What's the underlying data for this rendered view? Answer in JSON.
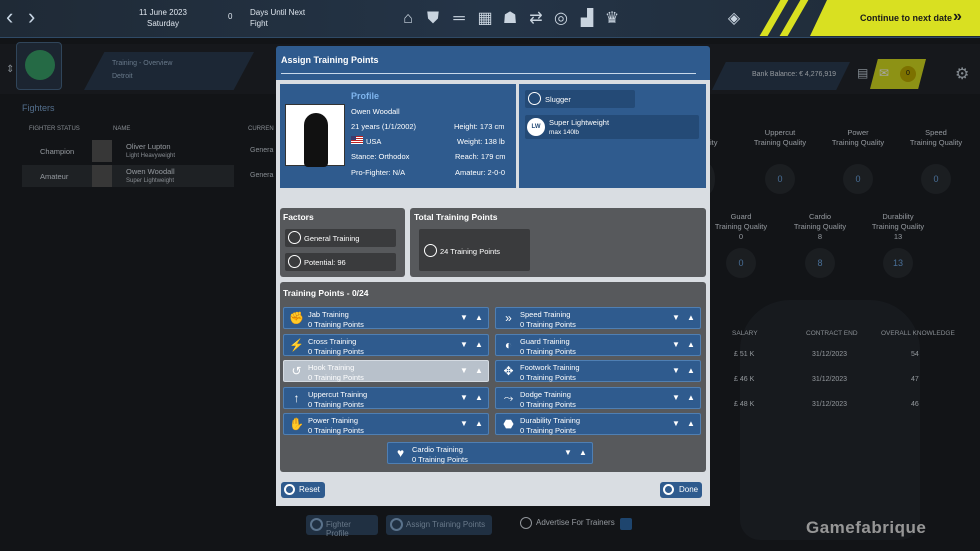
{
  "topbar": {
    "date": "11 June 2023",
    "weekday": "Saturday",
    "days_value": "0",
    "days_label_1": "Days Until Next",
    "days_label_2": "Fight",
    "continue_label": "Continue to next date",
    "nav_icons": [
      "home-icon",
      "shield-icon",
      "dumbbell-icon",
      "calendar-icon",
      "team-icon",
      "transfer-icon",
      "target-icon",
      "stats-icon",
      "trophy-icon"
    ]
  },
  "header": {
    "crumb_title": "Training - Overview",
    "crumb_location": "Detroit",
    "bank_balance": "Bank Balance: € 4,276,919",
    "mail_count": "0"
  },
  "fighters": {
    "title": "Fighters",
    "col_status": "FIGHTER STATUS",
    "col_name": "NAME",
    "col_current": "CURREN",
    "rows": [
      {
        "status": "Champion",
        "name": "Oliver Lupton",
        "weight": "Light Heavyweight",
        "current": "Genera"
      },
      {
        "status": "Amateur",
        "name": "Owen Woodall",
        "weight": "Super Lightweight",
        "current": "Genera"
      }
    ]
  },
  "stats": {
    "row1": [
      {
        "title1": "Uppercut",
        "title2": "Training Quality",
        "value": "0"
      },
      {
        "title1": "Power",
        "title2": "Training Quality",
        "value": "0"
      },
      {
        "title1": "Speed",
        "title2": "Training Quality",
        "value": "0"
      }
    ],
    "row1_partial": "uality",
    "row1_partial_value": "0",
    "row2": [
      {
        "title1": "Guard",
        "title2": "Training Quality",
        "num": "0",
        "value": "0"
      },
      {
        "title1": "Cardio",
        "title2": "Training Quality",
        "num": "8",
        "value": "8"
      },
      {
        "title1": "Durability",
        "title2": "Training Quality",
        "num": "13",
        "value": "13"
      }
    ]
  },
  "coaches": {
    "headers": [
      "SALARY",
      "CONTRACT END",
      "OVERALL KNOWLEDGE"
    ],
    "rows": [
      [
        "£ 51 K",
        "31/12/2023",
        "54"
      ],
      [
        "£ 46 K",
        "31/12/2023",
        "47"
      ],
      [
        "£ 48 K",
        "31/12/2023",
        "46"
      ]
    ]
  },
  "page_buttons": {
    "fighter_profile": "Fighter Profile",
    "assign_training": "Assign Training Points",
    "advertise": "Advertise For Trainers"
  },
  "watermark": "Gamefabrique",
  "modal": {
    "title": "Assign Training Points",
    "profile": {
      "heading": "Profile",
      "name": "Owen Woodall",
      "age": "21 years (1/1/2002)",
      "country": "USA",
      "stance": "Stance: Orthodox",
      "pro": "Pro-Fighter: N/A",
      "height": "Height: 173 cm",
      "weight": "Weight: 138 lb",
      "reach": "Reach: 179 cm",
      "amateur": "Amateur: 2-0-0"
    },
    "style": "Slugger",
    "weight_class": "Super Lightweight",
    "weight_max": "max 140lb",
    "weight_badge": "LW",
    "factors_title": "Factors",
    "factors": [
      "General Training",
      "Potential: 96"
    ],
    "total_title": "Total Training Points",
    "total_value": "24 Training Points",
    "training_title": "Training Points - 0/24",
    "training_left": [
      {
        "name": "Jab Training",
        "points": "0  Training Points",
        "icon": "jab-icon"
      },
      {
        "name": "Cross Training",
        "points": "0  Training Points",
        "icon": "cross-icon"
      },
      {
        "name": "Hook Training",
        "points": "0  Training Points",
        "icon": "hook-icon"
      },
      {
        "name": "Uppercut Training",
        "points": "0  Training Points",
        "icon": "uppercut-icon"
      },
      {
        "name": "Power Training",
        "points": "0  Training Points",
        "icon": "power-icon"
      }
    ],
    "training_right": [
      {
        "name": "Speed Training",
        "points": "0  Training Points",
        "icon": "speed-icon"
      },
      {
        "name": "Guard Training",
        "points": "0  Training Points",
        "icon": "guard-icon"
      },
      {
        "name": "Footwork Training",
        "points": "0  Training Points",
        "icon": "footwork-icon"
      },
      {
        "name": "Dodge Training",
        "points": "0  Training Points",
        "icon": "dodge-icon"
      },
      {
        "name": "Durability Training",
        "points": "0  Training Points",
        "icon": "durability-icon"
      }
    ],
    "cardio": {
      "name": "Cardio Training",
      "points": "0  Training Points",
      "icon": "heart-icon"
    },
    "reset": "Reset",
    "done": "Done"
  }
}
